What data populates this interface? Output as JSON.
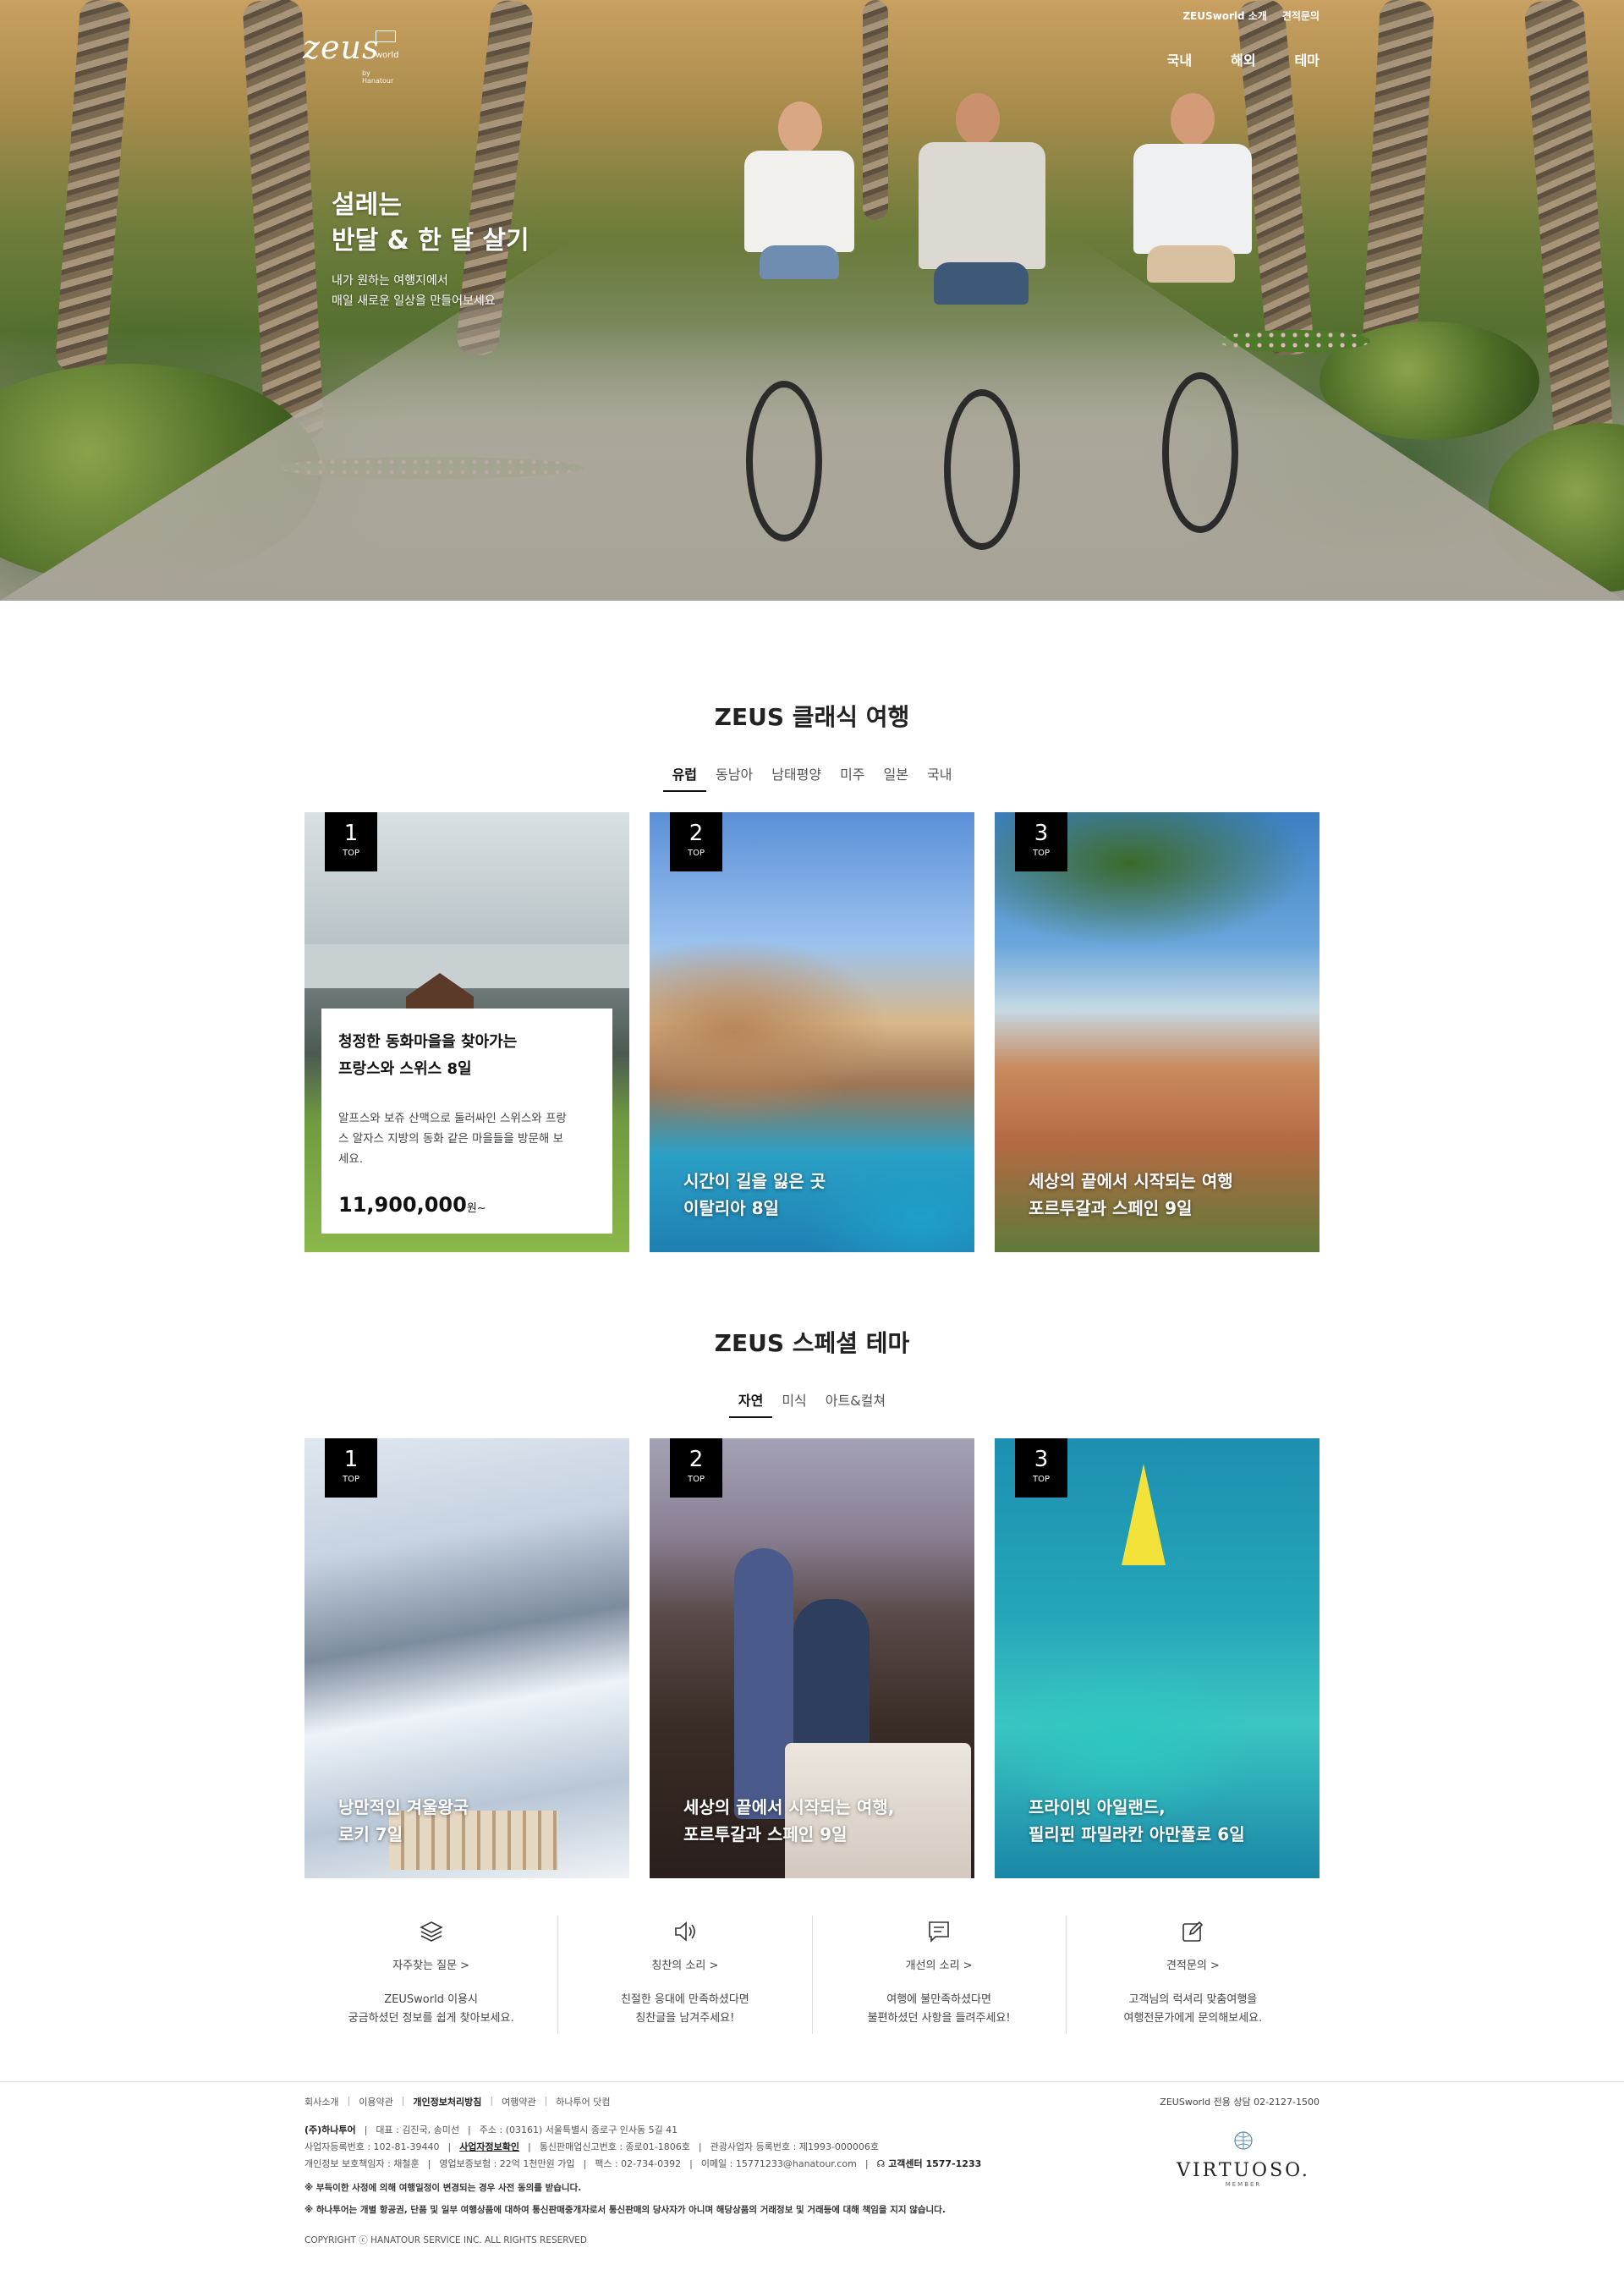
{
  "brand": {
    "logo_word": "zeus",
    "logo_sub": "world",
    "logo_by": "by Hanatour"
  },
  "top_nav": {
    "small": [
      "ZEUSworld 소개",
      "견적문의"
    ],
    "main": [
      "국내",
      "해외",
      "테마"
    ]
  },
  "hero": {
    "title_line1": "설레는",
    "title_line2": "반달 & 한 달 살기",
    "desc_line1": "내가 원하는 여행지에서",
    "desc_line2": "매일 새로운 일상을 만들어보세요"
  },
  "classic": {
    "title": "ZEUS 클래식 여행",
    "tabs": [
      "유럽",
      "동남아",
      "남태평양",
      "미주",
      "일본",
      "국내"
    ],
    "active_tab": 0,
    "cards": [
      {
        "rank": "1",
        "rank_label": "TOP",
        "title_line1": "청정한 동화마을을 찾아가는",
        "title_line2": "프랑스와 스위스 8일",
        "desc_line1": "알프스와 보쥬 산맥으로 둘러싸인 스위스와 프랑",
        "desc_line2": "스 알자스 지방의 동화 같은 마을들을 방문해 보",
        "desc_line3": "세요.",
        "price": "11,900,000",
        "price_unit": "원~"
      },
      {
        "rank": "2",
        "rank_label": "TOP",
        "title_line1": "시간이 길을 잃은 곳",
        "title_line2": "이탈리아 8일"
      },
      {
        "rank": "3",
        "rank_label": "TOP",
        "title_line1": "세상의 끝에서 시작되는 여행",
        "title_line2": "포르투갈과 스페인 9일"
      }
    ]
  },
  "special": {
    "title": "ZEUS 스페셜 테마",
    "tabs": [
      "자연",
      "미식",
      "아트&컬쳐"
    ],
    "active_tab": 0,
    "cards": [
      {
        "rank": "1",
        "rank_label": "TOP",
        "title_line1": "낭만적인 겨울왕국",
        "title_line2": "로키 7일"
      },
      {
        "rank": "2",
        "rank_label": "TOP",
        "title_line1": "세상의 끝에서 시작되는 여행,",
        "title_line2": "포르투갈과 스페인 9일"
      },
      {
        "rank": "3",
        "rank_label": "TOP",
        "title_line1": "프라이빗 아일랜드,",
        "title_line2": "필리핀 파밀라칸 아만풀로 6일"
      }
    ]
  },
  "services": [
    {
      "icon": "layers-icon",
      "link": "자주찾는 질문 >",
      "desc_line1": "ZEUSworld 이용시",
      "desc_line2": "궁금하셨던 정보를 쉽게 찾아보세요."
    },
    {
      "icon": "speaker-icon",
      "link": "칭찬의 소리 >",
      "desc_line1": "친절한 응대에 만족하셨다면",
      "desc_line2": "칭찬글을 남겨주세요!"
    },
    {
      "icon": "message-icon",
      "link": "개선의 소리 >",
      "desc_line1": "여행에 불만족하셨다면",
      "desc_line2": "불편하셨던 사항을 들려주세요!"
    },
    {
      "icon": "edit-icon",
      "link": "견적문의 >",
      "desc_line1": "고객님의 럭셔리 맞춤여행을",
      "desc_line2": "여행전문가에게 문의해보세요."
    }
  ],
  "footer": {
    "links": [
      "회사소개",
      "이용약관",
      "개인정보처리방침",
      "여행약관",
      "하나투어 닷컴"
    ],
    "bold_link_index": 2,
    "consult": "ZEUSworld 전용 상담 02-2127-1500",
    "company": "(주)하나투어",
    "row1": [
      "대표 : 김진국, 송미선",
      "주소 : (03161) 서울특별시 종로구 인사동 5길 41"
    ],
    "row2": [
      "사업자등록번호 : 102-81-39440",
      "사업자정보확인",
      "통신판매업신고번호 : 종로01-1806호",
      "관광사업자 등록번호 : 제1993-000006호"
    ],
    "row3": [
      "개인정보 보호책임자 : 채철훈",
      "영업보증보험 : 22억 1천만원 가입",
      "팩스 : 02-734-0392",
      "이메일 : 15771233@hanatour.com",
      "고객센터 1577-1233"
    ],
    "notice1": "※ 부득이한 사정에 의해 여행일정이 변경되는 경우 사전 동의를 받습니다.",
    "notice2": "※ 하나투어는 개별 항공권, 단품 및 일부 여행상품에 대하여 통신판매중개자로서 통신판매의 당사자가 아니며 해당상품의 거래정보 및 거래등에 대해 책임을 지지 않습니다.",
    "copyright": "COPYRIGHT ⓒ HANATOUR SERVICE INC. ALL RIGHTS RESERVED",
    "virtuoso": "VIRTUOSO.",
    "virtuoso_sub": "MEMBER"
  }
}
